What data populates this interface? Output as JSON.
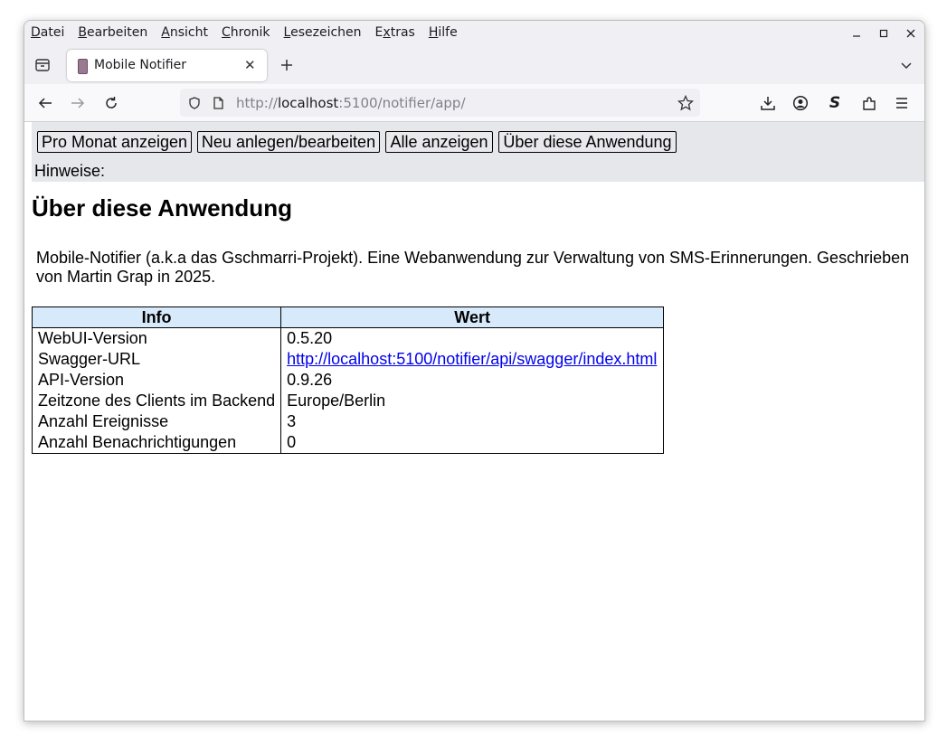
{
  "browser": {
    "menu": [
      {
        "label": "Datei",
        "key": "D",
        "rest": "atei"
      },
      {
        "label": "Bearbeiten",
        "key": "B",
        "rest": "earbeiten"
      },
      {
        "label": "Ansicht",
        "key": "A",
        "rest": "nsicht"
      },
      {
        "label": "Chronik",
        "key": "C",
        "rest": "hronik"
      },
      {
        "label": "Lesezeichen",
        "key": "L",
        "rest": "esezeichen"
      },
      {
        "label": "Extras",
        "pre": "E",
        "key": "x",
        "rest": "tras"
      },
      {
        "label": "Hilfe",
        "key": "H",
        "rest": "ilfe"
      }
    ],
    "tab_title": "Mobile Notifier",
    "url_scheme": "http://",
    "url_host": "localhost",
    "url_rest": ":5100/notifier/app/",
    "icons": {
      "minimize": "minimize-icon",
      "maximize": "maximize-icon",
      "close": "close-icon",
      "back": "back-arrow-icon",
      "forward": "forward-arrow-icon",
      "reload": "reload-icon",
      "star": "bookmark-star-icon",
      "download": "download-icon",
      "account": "account-icon",
      "extension": "extension-icon",
      "menu": "hamburger-menu-icon"
    }
  },
  "app": {
    "nav": {
      "month": "Pro Monat anzeigen",
      "edit": "Neu anlegen/bearbeiten",
      "all": "Alle anzeigen",
      "about": "Über diese Anwendung"
    },
    "hints_label": "Hinweise:",
    "heading": "Über diese Anwendung",
    "description": "Mobile-Notifier (a.k.a das Gschmarri-Projekt). Eine Webanwendung zur Verwaltung von SMS-Erinnerungen. Geschrieben von Martin Grap in 2025.",
    "table": {
      "headers": [
        "Info",
        "Wert"
      ],
      "rows": [
        {
          "info": "WebUI-Version",
          "value": "0.5.20"
        },
        {
          "info": "Swagger-URL",
          "value": "http://localhost:5100/notifier/api/swagger/index.html",
          "link": true
        },
        {
          "info": "API-Version",
          "value": "0.9.26"
        },
        {
          "info": "Zeitzone des Clients im Backend",
          "value": "Europe/Berlin"
        },
        {
          "info": "Anzahl Ereignisse",
          "value": "3"
        },
        {
          "info": "Anzahl Benachrichtigungen",
          "value": "0"
        }
      ]
    },
    "colors": {
      "nav_bg": "#e5e7eb",
      "table_header_bg": "#d7eafb",
      "link": "#0000ee"
    }
  }
}
